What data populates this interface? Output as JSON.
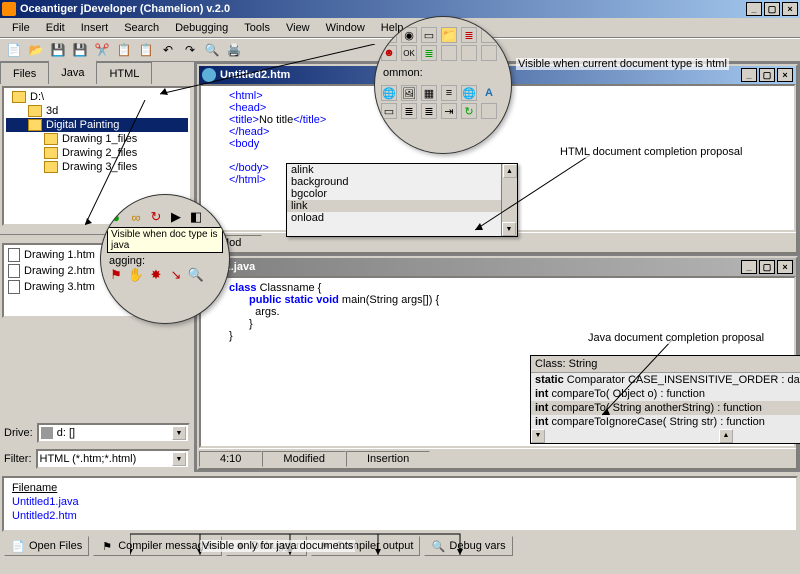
{
  "window": {
    "title": "Oceantiger jDeveloper (Chamelion) v.2.0"
  },
  "menus": [
    "File",
    "Edit",
    "Insert",
    "Search",
    "Debugging",
    "Tools",
    "View",
    "Window",
    "Help"
  ],
  "sidebar_tabs": [
    "Files",
    "Java",
    "HTML"
  ],
  "tree": {
    "root": "D:\\",
    "items": [
      "3d",
      "Digital Painting",
      "Drawing 1_files",
      "Drawing 2_files",
      "Drawing 3_files"
    ],
    "selected": "Digital Painting"
  },
  "file_list": [
    "Drawing 1.htm",
    "Drawing 2.htm",
    "Drawing 3.htm"
  ],
  "drive": {
    "label": "Drive:",
    "value": "d: []"
  },
  "filter": {
    "label": "Filter:",
    "value": "HTML (*.htm;*.html)"
  },
  "doc1": {
    "title": "Untitled2.htm",
    "lines": {
      "l1_open": "<html>",
      "l2_open": "<head>",
      "l3_open": "<title>",
      "l3_text": "No title",
      "l3_close": "</title>",
      "l4_close": "</head>",
      "l5_open": "<body ",
      "l6_close": "</body>",
      "l7_close": "</html>"
    },
    "completion": [
      "alink",
      "background",
      "bgcolor",
      "link",
      "onload"
    ],
    "completion_sel": "link",
    "status_mod": "Mod"
  },
  "doc2": {
    "title": "itled1.java",
    "lines": {
      "l1a": "class",
      "l1b": " Classname {",
      "l2a": "public static void",
      "l2b": " main(String args[]) {",
      "l3": "args.",
      "l4": "}",
      "l5": "}"
    },
    "completion": {
      "header": "Class: String",
      "items": [
        {
          "pre": "static",
          "txt": " Comparator CASE_INSENSITIVE_ORDER : datamember"
        },
        {
          "pre": "int",
          "txt": " compareTo( Object o) : function"
        },
        {
          "pre": "int",
          "txt": " compareTo( String anotherString) : function"
        },
        {
          "pre": "int",
          "txt": " compareToIgnoreCase( String str) : function"
        }
      ],
      "sel": 2
    },
    "status": {
      "pos": "4:10",
      "mod": "Modified",
      "ins": "Insertion"
    }
  },
  "filename_box": {
    "label": "Filename",
    "files": [
      "Untitled1.java",
      "Untitled2.htm"
    ]
  },
  "bottom_tabs": [
    {
      "icon": "📄",
      "label": "Open Files"
    },
    {
      "icon": "⚑",
      "label": "Compiler messages"
    },
    {
      "icon": "✸",
      "label": "Debugger"
    },
    {
      "icon": "⚑",
      "label": "Compiler output"
    },
    {
      "icon": "🔍",
      "label": "Debug vars"
    }
  ],
  "annotations": {
    "a1": "Visible when current document type is html",
    "a2": "HTML document completion proposal",
    "a3": "Java document completion proposal",
    "a4": "Visible only for java documents",
    "a5": "Visible when doc type is java",
    "a6": "agging:",
    "lens2_caption": "ommon:"
  }
}
